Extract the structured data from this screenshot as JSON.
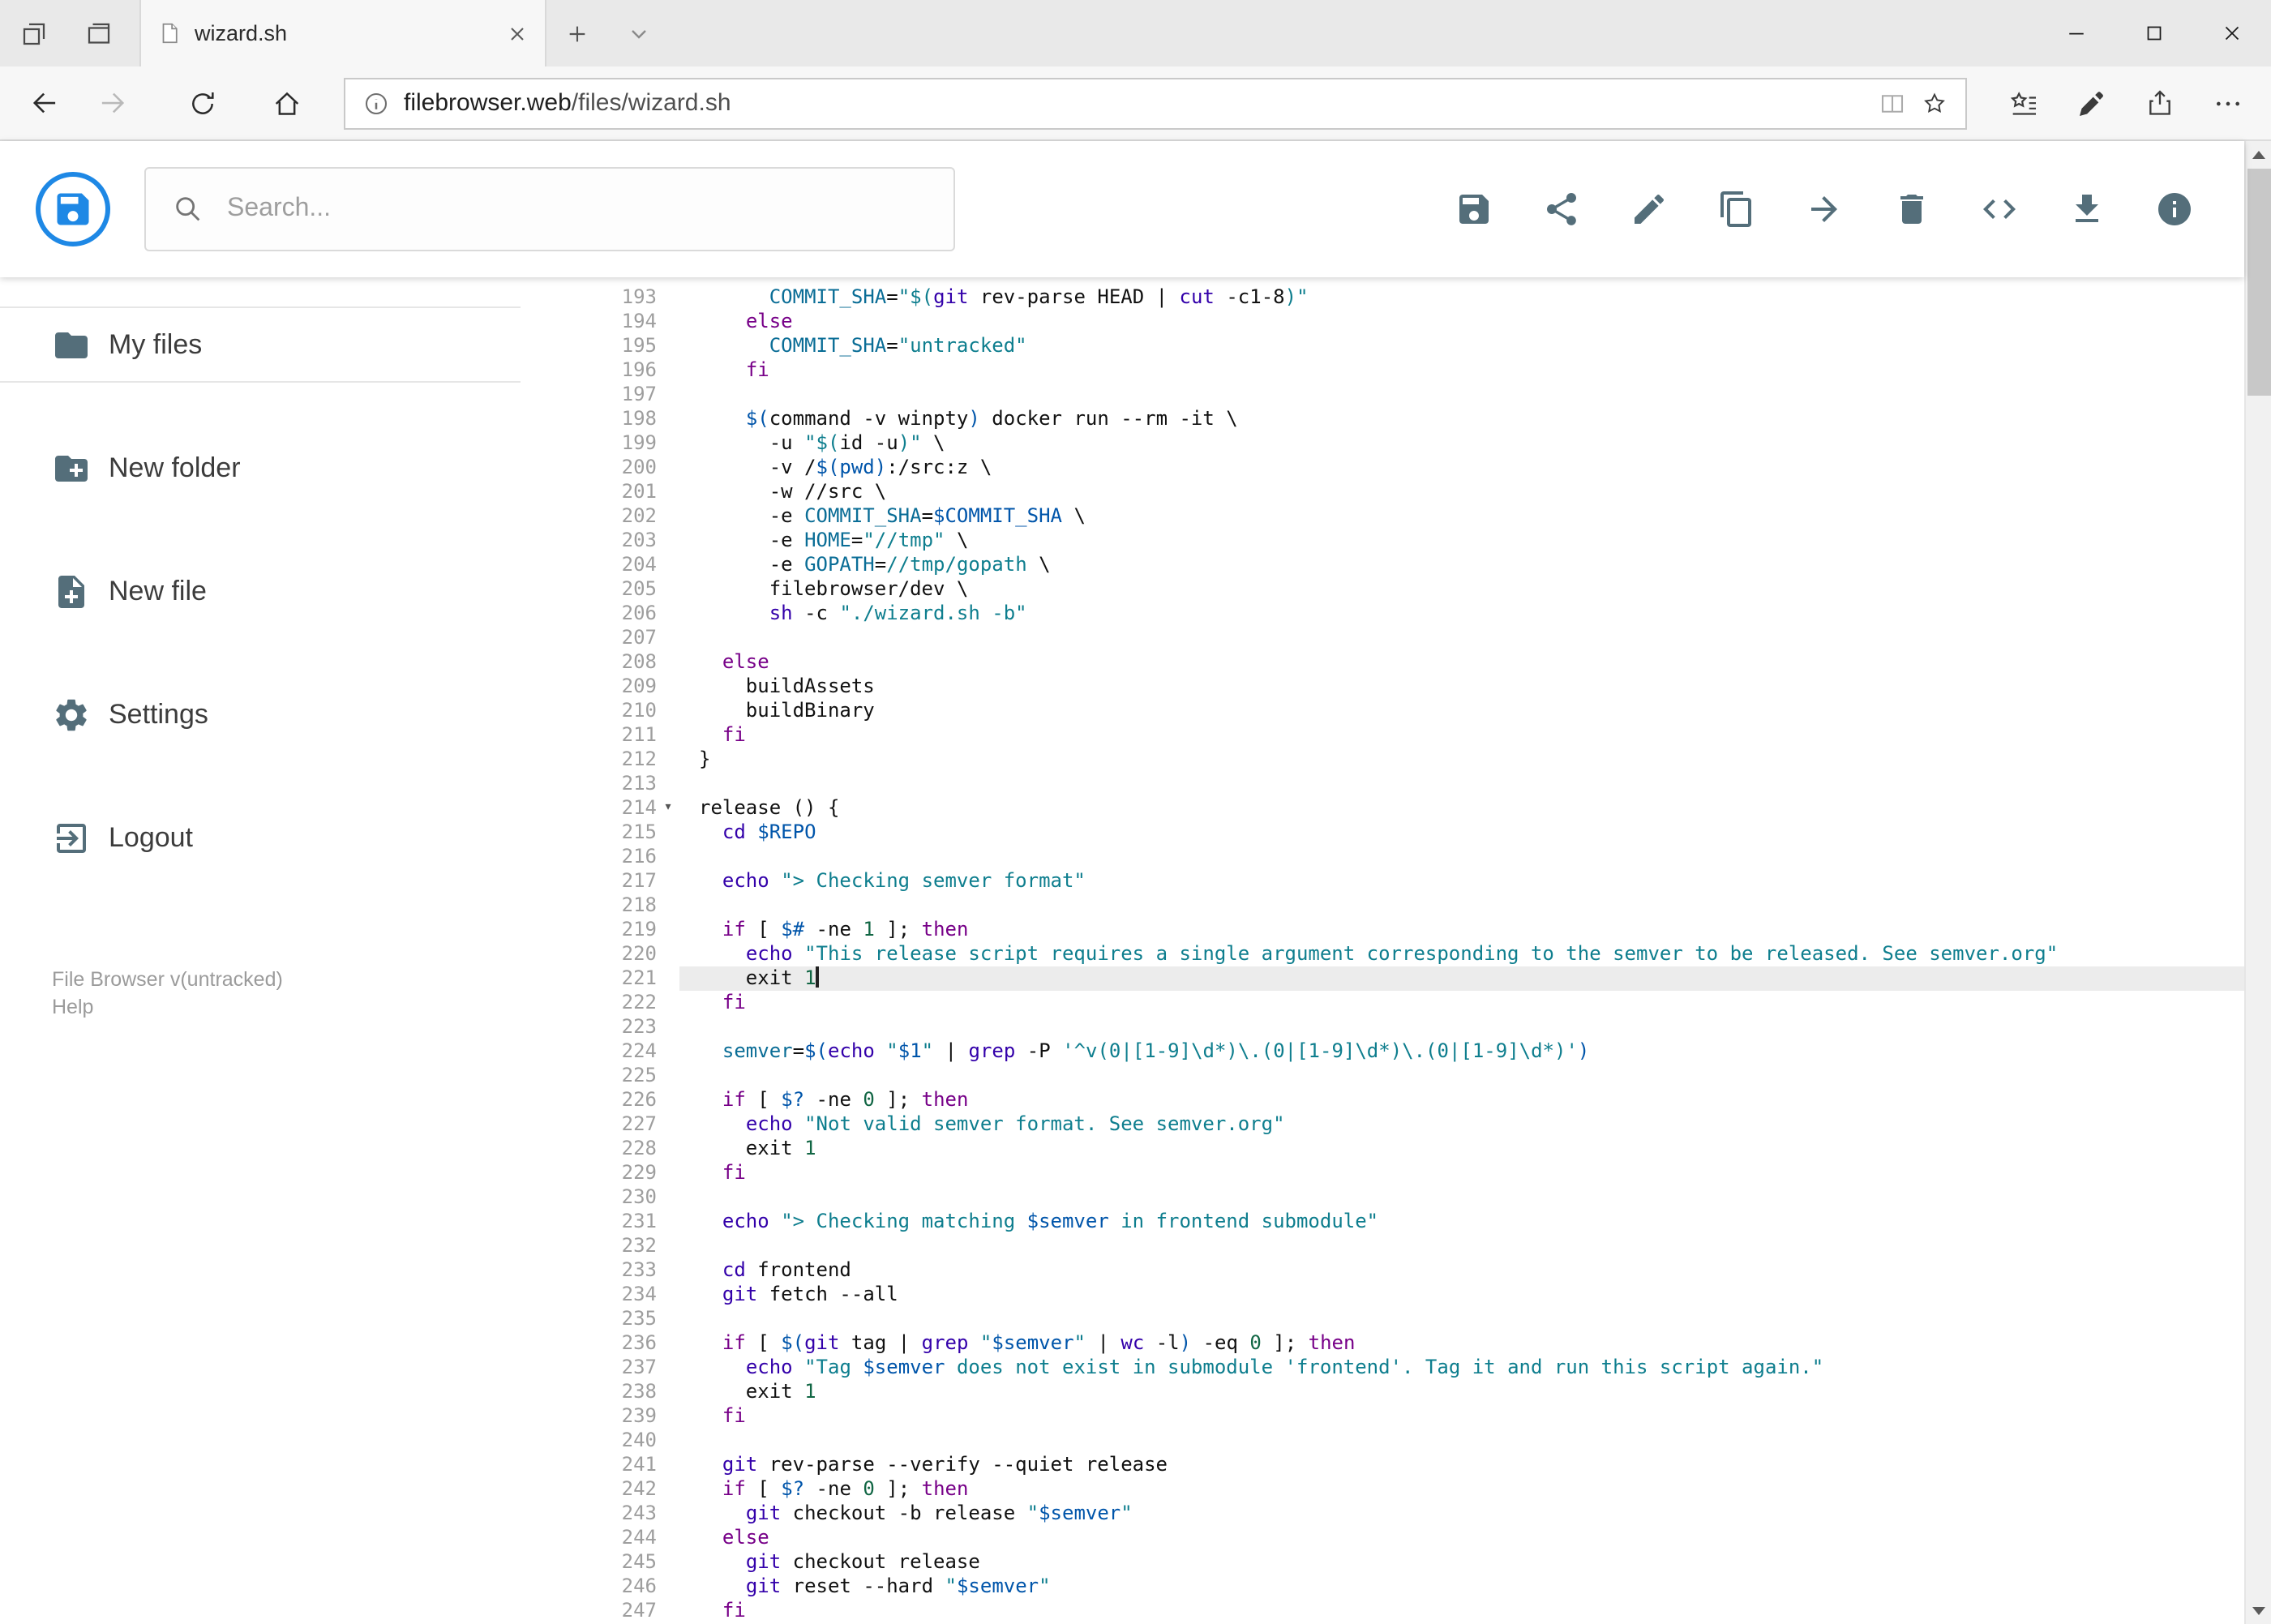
{
  "browser": {
    "tab_title": "wizard.sh",
    "url_domain": "filebrowser.web",
    "url_path": "/files/wizard.sh"
  },
  "app": {
    "search_placeholder": "Search...",
    "toolbar": [
      {
        "name": "save",
        "icon": "save-icon"
      },
      {
        "name": "share",
        "icon": "share-icon"
      },
      {
        "name": "edit",
        "icon": "edit-icon"
      },
      {
        "name": "copy",
        "icon": "copy-icon"
      },
      {
        "name": "move",
        "icon": "move-icon"
      },
      {
        "name": "delete",
        "icon": "delete-icon"
      },
      {
        "name": "code",
        "icon": "code-icon"
      },
      {
        "name": "download",
        "icon": "download-icon"
      },
      {
        "name": "info",
        "icon": "info-icon"
      }
    ],
    "sidebar": {
      "items": [
        {
          "label": "My files",
          "icon": "folder-icon"
        },
        {
          "label": "New folder",
          "icon": "new-folder-icon"
        },
        {
          "label": "New file",
          "icon": "new-file-icon"
        },
        {
          "label": "Settings",
          "icon": "settings-icon"
        },
        {
          "label": "Logout",
          "icon": "logout-icon"
        }
      ],
      "footer_version": "File Browser v(untracked)",
      "footer_help": "Help"
    }
  },
  "editor": {
    "active_line": 221,
    "fold_line": 214,
    "lines": [
      {
        "n": 193,
        "t": [
          [
            "p",
            "      "
          ],
          [
            "df",
            "COMMIT_SHA"
          ],
          [
            "p",
            "="
          ],
          [
            "st",
            "\"$("
          ],
          [
            "bi",
            "git"
          ],
          [
            "p",
            " rev-parse HEAD | "
          ],
          [
            "bi",
            "cut"
          ],
          [
            "p",
            " -c1-8"
          ],
          [
            "st",
            ")\""
          ]
        ]
      },
      {
        "n": 194,
        "t": [
          [
            "p",
            "    "
          ],
          [
            "kw",
            "else"
          ]
        ]
      },
      {
        "n": 195,
        "t": [
          [
            "p",
            "      "
          ],
          [
            "df",
            "COMMIT_SHA"
          ],
          [
            "p",
            "="
          ],
          [
            "st",
            "\"untracked\""
          ]
        ]
      },
      {
        "n": 196,
        "t": [
          [
            "p",
            "    "
          ],
          [
            "kw",
            "fi"
          ]
        ]
      },
      {
        "n": 197,
        "t": []
      },
      {
        "n": 198,
        "t": [
          [
            "p",
            "    "
          ],
          [
            "vr",
            "$("
          ],
          [
            "p",
            "command -v winpty"
          ],
          [
            "vr",
            ")"
          ],
          [
            "p",
            " docker run --rm -it \\"
          ]
        ]
      },
      {
        "n": 199,
        "t": [
          [
            "p",
            "      -u "
          ],
          [
            "st",
            "\"$("
          ],
          [
            "p",
            "id -u"
          ],
          [
            "st",
            ")\""
          ],
          [
            "p",
            " \\"
          ]
        ]
      },
      {
        "n": 200,
        "t": [
          [
            "p",
            "      -v /"
          ],
          [
            "vr",
            "$(pwd)"
          ],
          [
            "p",
            ":/src:z \\"
          ]
        ]
      },
      {
        "n": 201,
        "t": [
          [
            "p",
            "      -w //src \\"
          ]
        ]
      },
      {
        "n": 202,
        "t": [
          [
            "p",
            "      -e "
          ],
          [
            "df",
            "COMMIT_SHA"
          ],
          [
            "p",
            "="
          ],
          [
            "vr",
            "$COMMIT_SHA"
          ],
          [
            "p",
            " \\"
          ]
        ]
      },
      {
        "n": 203,
        "t": [
          [
            "p",
            "      -e "
          ],
          [
            "df",
            "HOME"
          ],
          [
            "p",
            "="
          ],
          [
            "st",
            "\"//tmp\""
          ],
          [
            "p",
            " \\"
          ]
        ]
      },
      {
        "n": 204,
        "t": [
          [
            "p",
            "      -e "
          ],
          [
            "df",
            "GOPATH"
          ],
          [
            "p",
            "="
          ],
          [
            "st",
            "//tmp/gopath"
          ],
          [
            "p",
            " \\"
          ]
        ]
      },
      {
        "n": 205,
        "t": [
          [
            "p",
            "      filebrowser/dev \\"
          ]
        ]
      },
      {
        "n": 206,
        "t": [
          [
            "p",
            "      "
          ],
          [
            "bi",
            "sh"
          ],
          [
            "p",
            " -c "
          ],
          [
            "st",
            "\"./wizard.sh -b\""
          ]
        ]
      },
      {
        "n": 207,
        "t": []
      },
      {
        "n": 208,
        "t": [
          [
            "p",
            "  "
          ],
          [
            "kw",
            "else"
          ]
        ]
      },
      {
        "n": 209,
        "t": [
          [
            "p",
            "    buildAssets"
          ]
        ]
      },
      {
        "n": 210,
        "t": [
          [
            "p",
            "    buildBinary"
          ]
        ]
      },
      {
        "n": 211,
        "t": [
          [
            "p",
            "  "
          ],
          [
            "kw",
            "fi"
          ]
        ]
      },
      {
        "n": 212,
        "t": [
          [
            "p",
            "}"
          ]
        ]
      },
      {
        "n": 213,
        "t": []
      },
      {
        "n": 214,
        "t": [
          [
            "p",
            "release () {"
          ]
        ]
      },
      {
        "n": 215,
        "t": [
          [
            "p",
            "  "
          ],
          [
            "bi",
            "cd"
          ],
          [
            "p",
            " "
          ],
          [
            "vr",
            "$REPO"
          ]
        ]
      },
      {
        "n": 216,
        "t": []
      },
      {
        "n": 217,
        "t": [
          [
            "p",
            "  "
          ],
          [
            "bi",
            "echo"
          ],
          [
            "p",
            " "
          ],
          [
            "st",
            "\"> Checking semver format\""
          ]
        ]
      },
      {
        "n": 218,
        "t": []
      },
      {
        "n": 219,
        "t": [
          [
            "p",
            "  "
          ],
          [
            "kw",
            "if"
          ],
          [
            "p",
            " [ "
          ],
          [
            "vr",
            "$#"
          ],
          [
            "p",
            " -ne "
          ],
          [
            "nm",
            "1"
          ],
          [
            "p",
            " ]; "
          ],
          [
            "kw",
            "then"
          ]
        ]
      },
      {
        "n": 220,
        "t": [
          [
            "p",
            "    "
          ],
          [
            "bi",
            "echo"
          ],
          [
            "p",
            " "
          ],
          [
            "st",
            "\"This release script requires a single argument corresponding to the semver to be released. See semver.org\""
          ]
        ]
      },
      {
        "n": 221,
        "t": [
          [
            "p",
            "    exit "
          ],
          [
            "nm",
            "1"
          ]
        ]
      },
      {
        "n": 222,
        "t": [
          [
            "p",
            "  "
          ],
          [
            "kw",
            "fi"
          ]
        ]
      },
      {
        "n": 223,
        "t": []
      },
      {
        "n": 224,
        "t": [
          [
            "p",
            "  "
          ],
          [
            "df",
            "semver"
          ],
          [
            "p",
            "="
          ],
          [
            "vr",
            "$("
          ],
          [
            "bi",
            "echo"
          ],
          [
            "p",
            " "
          ],
          [
            "st",
            "\""
          ],
          [
            "vr",
            "$1"
          ],
          [
            "st",
            "\""
          ],
          [
            "p",
            " | "
          ],
          [
            "bi",
            "grep"
          ],
          [
            "p",
            " -P "
          ],
          [
            "st",
            "'^v(0|[1-9]\\d*)\\.(0|[1-9]\\d*)\\.(0|[1-9]\\d*)'"
          ],
          [
            "vr",
            ")"
          ]
        ]
      },
      {
        "n": 225,
        "t": []
      },
      {
        "n": 226,
        "t": [
          [
            "p",
            "  "
          ],
          [
            "kw",
            "if"
          ],
          [
            "p",
            " [ "
          ],
          [
            "vr",
            "$?"
          ],
          [
            "p",
            " -ne "
          ],
          [
            "nm",
            "0"
          ],
          [
            "p",
            " ]; "
          ],
          [
            "kw",
            "then"
          ]
        ]
      },
      {
        "n": 227,
        "t": [
          [
            "p",
            "    "
          ],
          [
            "bi",
            "echo"
          ],
          [
            "p",
            " "
          ],
          [
            "st",
            "\"Not valid semver format. See semver.org\""
          ]
        ]
      },
      {
        "n": 228,
        "t": [
          [
            "p",
            "    exit "
          ],
          [
            "nm",
            "1"
          ]
        ]
      },
      {
        "n": 229,
        "t": [
          [
            "p",
            "  "
          ],
          [
            "kw",
            "fi"
          ]
        ]
      },
      {
        "n": 230,
        "t": []
      },
      {
        "n": 231,
        "t": [
          [
            "p",
            "  "
          ],
          [
            "bi",
            "echo"
          ],
          [
            "p",
            " "
          ],
          [
            "st",
            "\"> Checking matching "
          ],
          [
            "vr",
            "$semver"
          ],
          [
            "st",
            " in frontend submodule\""
          ]
        ]
      },
      {
        "n": 232,
        "t": []
      },
      {
        "n": 233,
        "t": [
          [
            "p",
            "  "
          ],
          [
            "bi",
            "cd"
          ],
          [
            "p",
            " frontend"
          ]
        ]
      },
      {
        "n": 234,
        "t": [
          [
            "p",
            "  "
          ],
          [
            "bi",
            "git"
          ],
          [
            "p",
            " fetch --all"
          ]
        ]
      },
      {
        "n": 235,
        "t": []
      },
      {
        "n": 236,
        "t": [
          [
            "p",
            "  "
          ],
          [
            "kw",
            "if"
          ],
          [
            "p",
            " [ "
          ],
          [
            "vr",
            "$("
          ],
          [
            "bi",
            "git"
          ],
          [
            "p",
            " tag | "
          ],
          [
            "bi",
            "grep"
          ],
          [
            "p",
            " "
          ],
          [
            "st",
            "\""
          ],
          [
            "vr",
            "$semver"
          ],
          [
            "st",
            "\""
          ],
          [
            "p",
            " | "
          ],
          [
            "bi",
            "wc"
          ],
          [
            "p",
            " -l"
          ],
          [
            "vr",
            ")"
          ],
          [
            "p",
            " -eq "
          ],
          [
            "nm",
            "0"
          ],
          [
            "p",
            " ]; "
          ],
          [
            "kw",
            "then"
          ]
        ]
      },
      {
        "n": 237,
        "t": [
          [
            "p",
            "    "
          ],
          [
            "bi",
            "echo"
          ],
          [
            "p",
            " "
          ],
          [
            "st",
            "\"Tag "
          ],
          [
            "vr",
            "$semver"
          ],
          [
            "st",
            " does not exist in submodule 'frontend'. Tag it and run this script again.\""
          ]
        ]
      },
      {
        "n": 238,
        "t": [
          [
            "p",
            "    exit "
          ],
          [
            "nm",
            "1"
          ]
        ]
      },
      {
        "n": 239,
        "t": [
          [
            "p",
            "  "
          ],
          [
            "kw",
            "fi"
          ]
        ]
      },
      {
        "n": 240,
        "t": []
      },
      {
        "n": 241,
        "t": [
          [
            "p",
            "  "
          ],
          [
            "bi",
            "git"
          ],
          [
            "p",
            " rev-parse --verify --quiet release"
          ]
        ]
      },
      {
        "n": 242,
        "t": [
          [
            "p",
            "  "
          ],
          [
            "kw",
            "if"
          ],
          [
            "p",
            " [ "
          ],
          [
            "vr",
            "$?"
          ],
          [
            "p",
            " -ne "
          ],
          [
            "nm",
            "0"
          ],
          [
            "p",
            " ]; "
          ],
          [
            "kw",
            "then"
          ]
        ]
      },
      {
        "n": 243,
        "t": [
          [
            "p",
            "    "
          ],
          [
            "bi",
            "git"
          ],
          [
            "p",
            " checkout -b release "
          ],
          [
            "st",
            "\""
          ],
          [
            "vr",
            "$semver"
          ],
          [
            "st",
            "\""
          ]
        ]
      },
      {
        "n": 244,
        "t": [
          [
            "p",
            "  "
          ],
          [
            "kw",
            "else"
          ]
        ]
      },
      {
        "n": 245,
        "t": [
          [
            "p",
            "    "
          ],
          [
            "bi",
            "git"
          ],
          [
            "p",
            " checkout release"
          ]
        ]
      },
      {
        "n": 246,
        "t": [
          [
            "p",
            "    "
          ],
          [
            "bi",
            "git"
          ],
          [
            "p",
            " reset --hard "
          ],
          [
            "st",
            "\""
          ],
          [
            "vr",
            "$semver"
          ],
          [
            "st",
            "\""
          ]
        ]
      },
      {
        "n": 247,
        "t": [
          [
            "p",
            "  "
          ],
          [
            "kw",
            "fi"
          ]
        ]
      }
    ]
  }
}
